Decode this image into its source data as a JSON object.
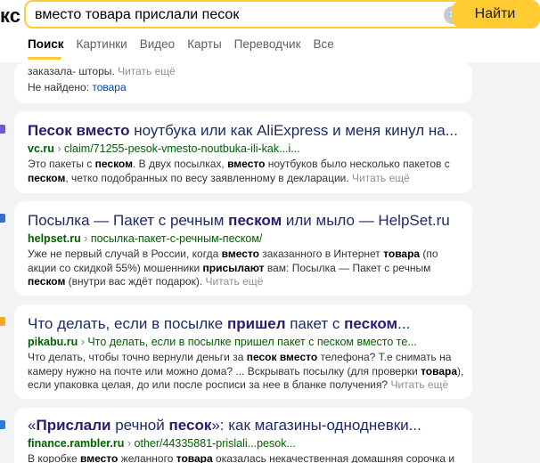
{
  "header": {
    "logo_fragment": "кс",
    "search_value": "вместо товара прислали песок",
    "clear_glyph": "×",
    "search_button": "Найти",
    "tabs": [
      "Поиск",
      "Картинки",
      "Видео",
      "Карты",
      "Переводчик",
      "Все"
    ]
  },
  "card0": {
    "snippet_tail": "заказала- шторы.",
    "more": "Читать ещё",
    "notfound_label": "Не найдено:",
    "notfound_word": "товара"
  },
  "card1": {
    "title_b": "Песок вместо",
    "title_rest": " ноутбука или как AliExpress и меня кинул на...",
    "domain": "vc.ru",
    "crumb": "claim/71255-pesok-vmesto-noutbuka-ili-kak...i...",
    "s1": "Это пакеты с ",
    "s2": "песком",
    "s3": ". В двух посылках, ",
    "s4": "вместо",
    "s5": " ноутбуков было несколько пакетов с ",
    "s6": "песком",
    "s7": ", четко подобранных по весу заявленному в декларации.",
    "more": "Читать ещё"
  },
  "card2": {
    "title_a": "Посылка — Пакет с речным ",
    "title_b": "песком",
    "title_c": " или мыло — HelpSet.ru",
    "domain": "helpset.ru",
    "crumb": "посылка-пакет-с-речным-песком/",
    "s1": "Уже не первый случай в России, когда ",
    "s2": "вместо",
    "s3": " заказанного в Интернет ",
    "s4": "товара",
    "s5": " (по акции со скидкой 55%) мошенники ",
    "s6": "присылают",
    "s7": " вам: Посылка — Пакет с речным ",
    "s8": "песком",
    "s9": " (внутри вас ждёт подарок).",
    "more": "Читать ещё"
  },
  "card3": {
    "title_a": "Что делать, если в посылке ",
    "title_b": "пришел",
    "title_c": " пакет с ",
    "title_d": "песком",
    "title_e": "...",
    "domain": "pikabu.ru",
    "crumb": "Что делать, если в посылке пришел пакет с песком вместо те...",
    "s1": "Что делать, чтобы точно вернули деньги за ",
    "s2": "песок вместо",
    "s3": " телефона? Т.е снимать на камеру нужно на почте или можно дома? ... Вскрывать посылку (для проверки ",
    "s4": "товара",
    "s5": "), если упаковка целая, до или после росписи за нее в бланке получения?",
    "more": "Читать ещё"
  },
  "card4": {
    "title_a": "«",
    "title_b": "Прислали",
    "title_c": " речной ",
    "title_d": "песок",
    "title_e": "»: как магазины-однодневки...",
    "domain": "finance.rambler.ru",
    "crumb": "other/44335881-prislali...pesok...",
    "s1": "В коробке ",
    "s2": "вместо",
    "s3": " желанного ",
    "s4": "товара",
    "s5": " оказалась некачественная домашняя сорочка и"
  },
  "arrow": "›",
  "colors": {
    "accent": "#ffcc33",
    "link": "#1f2a68",
    "url": "#006000"
  }
}
